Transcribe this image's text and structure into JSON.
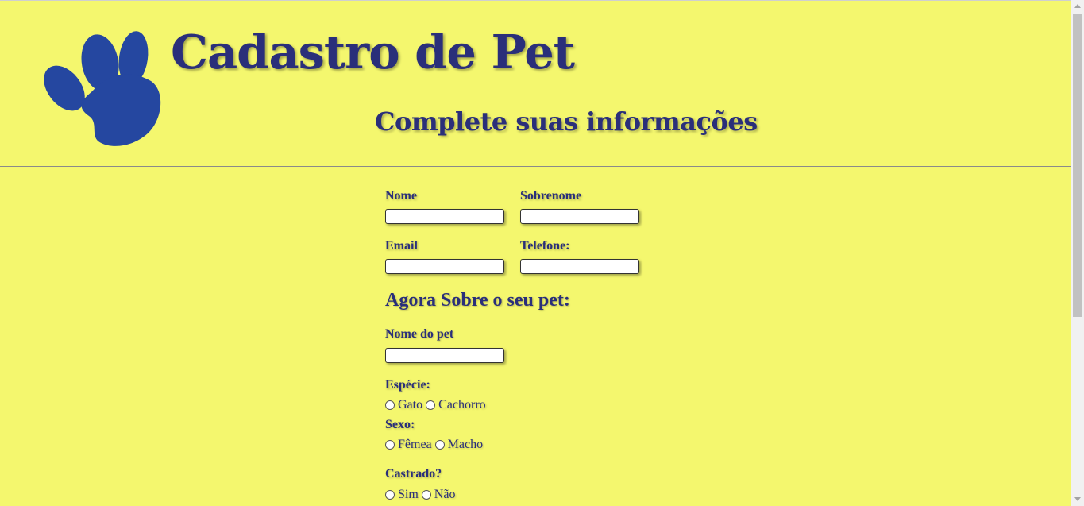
{
  "header": {
    "title": "Cadastro de Pet",
    "subtitle": "Complete suas informações",
    "logo_icon": "paw-icon"
  },
  "form": {
    "nome_label": "Nome",
    "sobrenome_label": "Sobrenome",
    "email_label": "Email",
    "telefone_label": "Telefone:",
    "pet_section_title": "Agora Sobre o seu pet:",
    "nome_pet_label": "Nome do pet",
    "especie_label": "Espécie:",
    "especie_options": [
      "Gato",
      "Cachorro"
    ],
    "sexo_label": "Sexo:",
    "sexo_options": [
      "Fêmea",
      "Macho"
    ],
    "castrado_label": "Castrado?",
    "castrado_options": [
      "Sim",
      "Não"
    ],
    "fields": {
      "nome": "",
      "sobrenome": "",
      "email": "",
      "telefone": "",
      "nome_pet": ""
    }
  },
  "colors": {
    "background": "#f4f76e",
    "text": "#2a2f7a",
    "logo": "#2547a0"
  }
}
